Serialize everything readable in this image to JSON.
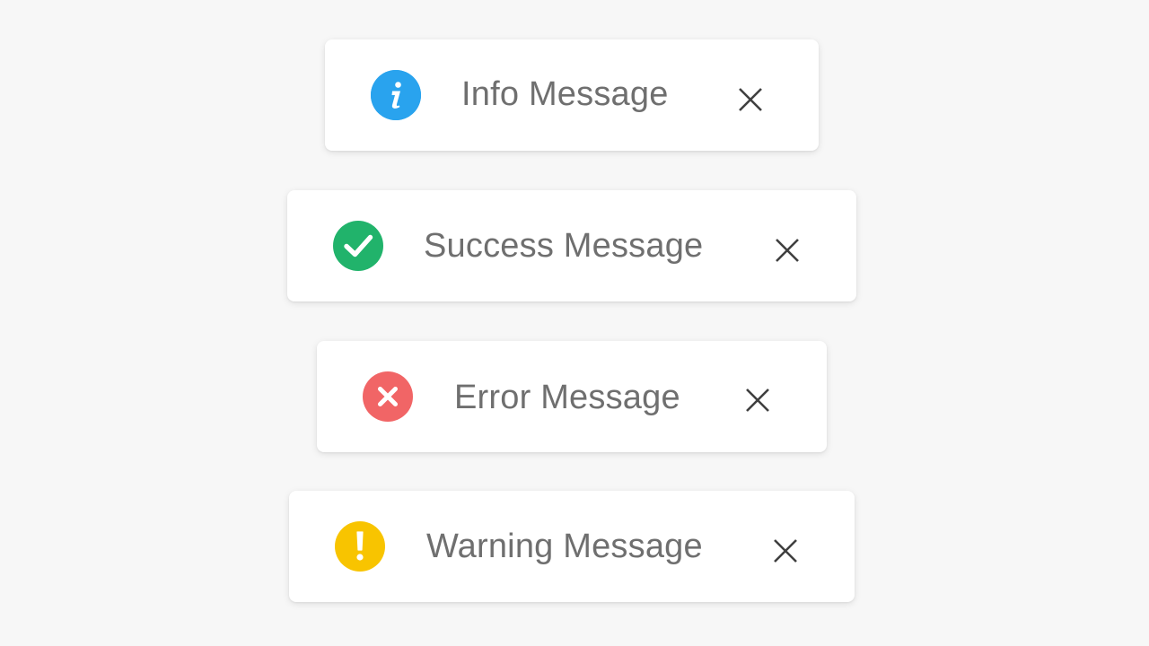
{
  "toasts": [
    {
      "type": "info",
      "icon": "info-icon",
      "color": "#2196f3",
      "message": "Info Message",
      "close_icon": "close-icon"
    },
    {
      "type": "success",
      "icon": "check-icon",
      "color": "#21b36b",
      "message": "Success Message",
      "close_icon": "close-icon"
    },
    {
      "type": "error",
      "icon": "error-x-icon",
      "color": "#f16566",
      "message": "Error Message",
      "close_icon": "close-icon"
    },
    {
      "type": "warning",
      "icon": "exclamation-icon",
      "color": "#f8c400",
      "message": "Warning Message",
      "close_icon": "close-icon"
    }
  ]
}
